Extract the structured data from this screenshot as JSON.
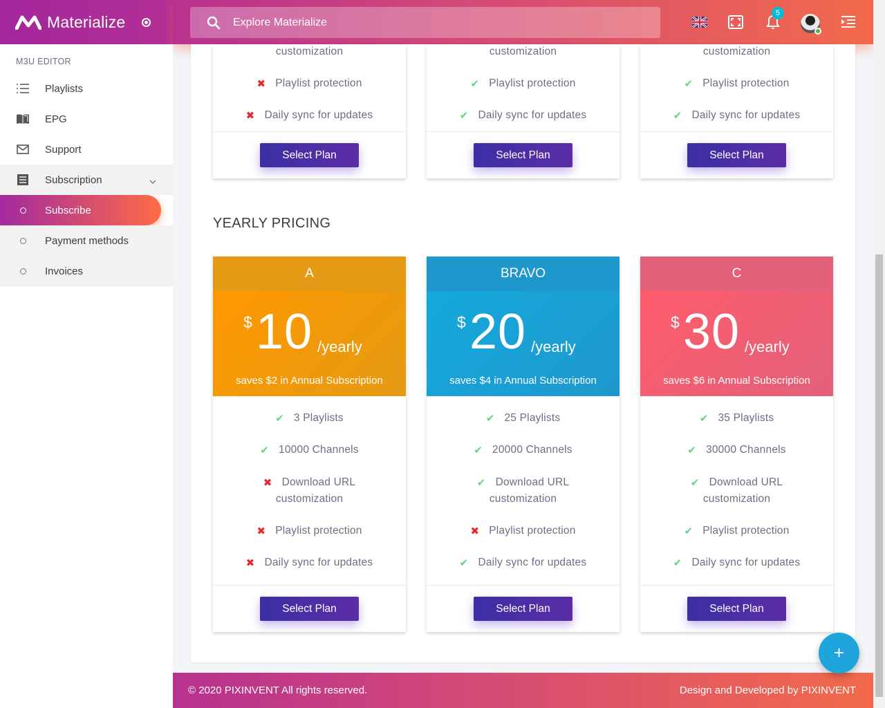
{
  "brand": {
    "name": "Materialize"
  },
  "search": {
    "placeholder": "Explore Materialize"
  },
  "header": {
    "notification_count": "5",
    "language": "English (UK)"
  },
  "sidebar": {
    "section": "M3U EDITOR",
    "items": [
      {
        "label": "Playlists",
        "icon": "list-icon"
      },
      {
        "label": "EPG",
        "icon": "book-icon"
      },
      {
        "label": "Support",
        "icon": "mail-icon"
      },
      {
        "label": "Subscription",
        "icon": "receipt-icon",
        "expanded": true
      }
    ],
    "subitems": [
      {
        "label": "Subscribe",
        "active": true
      },
      {
        "label": "Payment methods",
        "active": false
      },
      {
        "label": "Invoices",
        "active": false
      }
    ]
  },
  "monthly_cards": [
    {
      "features": [
        {
          "label": "customization",
          "included": null
        },
        {
          "label": "Playlist protection",
          "included": false
        },
        {
          "label": "Daily sync for updates",
          "included": false
        }
      ],
      "button": "Select Plan"
    },
    {
      "features": [
        {
          "label": "customization",
          "included": null
        },
        {
          "label": "Playlist protection",
          "included": true
        },
        {
          "label": "Daily sync for updates",
          "included": true
        }
      ],
      "button": "Select Plan"
    },
    {
      "features": [
        {
          "label": "customization",
          "included": null
        },
        {
          "label": "Playlist protection",
          "included": true
        },
        {
          "label": "Daily sync for updates",
          "included": true
        }
      ],
      "button": "Select Plan"
    }
  ],
  "yearly": {
    "title": "YEARLY PRICING",
    "plans": [
      {
        "name": "A",
        "currency": "$",
        "price": "10",
        "period": "/yearly",
        "saves": "saves $2 in Annual Subscription",
        "head_color": "#e49a14",
        "price_color": "#ff9800",
        "features": [
          {
            "label": "3 Playlists",
            "included": true
          },
          {
            "label": "10000 Channels",
            "included": true
          },
          {
            "label": "Download URL",
            "label2": "customization",
            "included": false
          },
          {
            "label": "Playlist protection",
            "included": false
          },
          {
            "label": "Daily sync for updates",
            "included": false
          }
        ],
        "button": "Select Plan"
      },
      {
        "name": "BRAVO",
        "currency": "$",
        "price": "20",
        "period": "/yearly",
        "saves": "saves $4 in Annual Subscription",
        "head_color": "#1e98cc",
        "price_color": "#15a9dc",
        "features": [
          {
            "label": "25 Playlists",
            "included": true
          },
          {
            "label": "20000 Channels",
            "included": true
          },
          {
            "label": "Download URL",
            "label2": "customization",
            "included": true
          },
          {
            "label": "Playlist protection",
            "included": false
          },
          {
            "label": "Daily sync for updates",
            "included": true
          }
        ],
        "button": "Select Plan"
      },
      {
        "name": "C",
        "currency": "$",
        "price": "30",
        "period": "/yearly",
        "saves": "saves $6 in Annual Subscription",
        "head_color": "#e2607a",
        "price_color": "#ff5d6c",
        "features": [
          {
            "label": "35 Playlists",
            "included": true
          },
          {
            "label": "30000 Channels",
            "included": true
          },
          {
            "label": "Download URL",
            "label2": "customization",
            "included": true
          },
          {
            "label": "Playlist protection",
            "included": true
          },
          {
            "label": "Daily sync for updates",
            "included": true
          }
        ],
        "button": "Select Plan"
      }
    ]
  },
  "footer": {
    "copyright": "© 2020 PIXINVENT All rights reserved.",
    "credit": "Design and Developed by PIXINVENT"
  },
  "fab": {
    "label": "+"
  }
}
